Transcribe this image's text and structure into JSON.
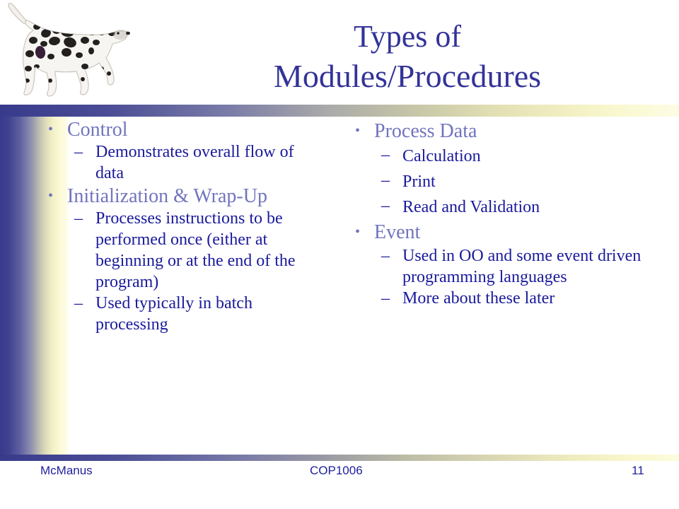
{
  "slide": {
    "title_line1": "Types of",
    "title_line2": "Modules/Procedures",
    "title_color": "#333399",
    "level1_color": "#7174be",
    "level2_color": "#1a1a9c",
    "band_start_color": "#383a8c",
    "band_end_color": "#fdfce4",
    "bullet_level1_glyph": "•",
    "bullet_level2_glyph": "–",
    "decoration_icon": "dalmatian-dog-image"
  },
  "columns": [
    {
      "id": "left",
      "items": [
        {
          "label": "Control",
          "sub": [
            "Demonstrates overall flow of data"
          ]
        },
        {
          "label": "Initialization & Wrap-Up",
          "sub": [
            "Processes instructions to be performed once (either at beginning or at the end of the program)",
            "Used typically in batch processing"
          ]
        }
      ]
    },
    {
      "id": "right",
      "items": [
        {
          "label": "Process Data",
          "sub": [
            "Calculation",
            "Print",
            "Read and Validation"
          ]
        },
        {
          "label": "Event",
          "sub": [
            "Used in OO and some event driven programming languages",
            "More about these later"
          ]
        }
      ]
    }
  ],
  "footer": {
    "author": "McManus",
    "course": "COP1006",
    "page": "11"
  }
}
